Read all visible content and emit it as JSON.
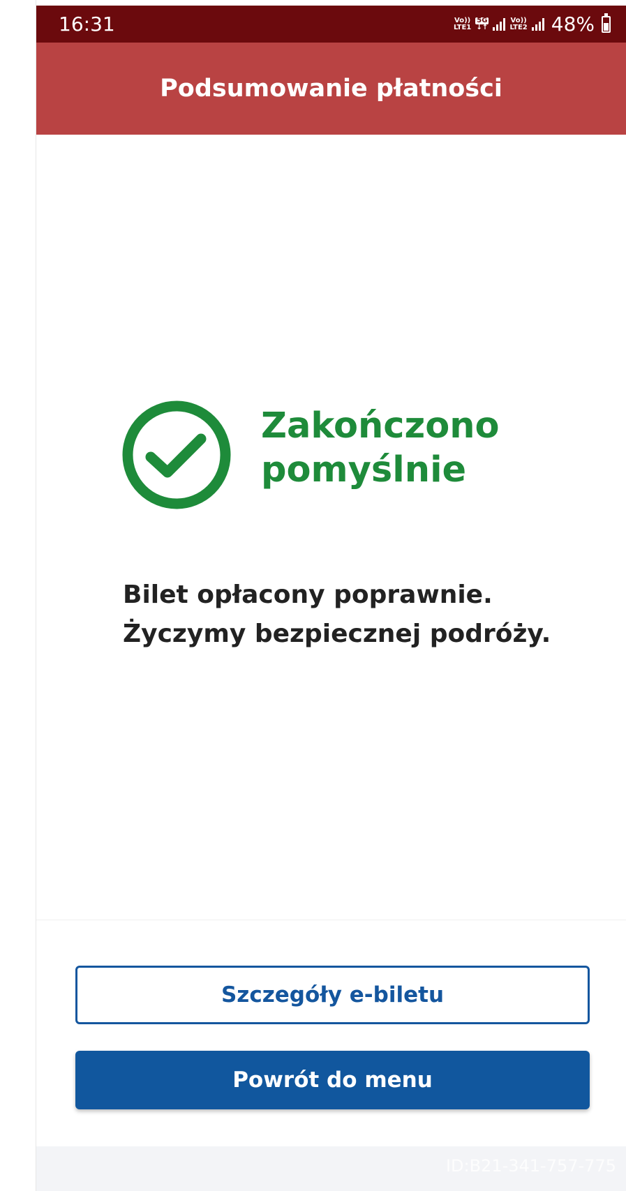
{
  "status_bar": {
    "time": "16:31",
    "network_1_top": "Vo))",
    "network_1_bottom": "LTE1",
    "network_5g": "5G",
    "network_2_top": "Vo))",
    "network_2_bottom": "LTE2",
    "battery_percent": "48%"
  },
  "header": {
    "title": "Podsumowanie płatności"
  },
  "result": {
    "status_line_1": "Zakończono",
    "status_line_2": "pomyślnie",
    "icon": "check-circle-icon",
    "color": "#1e8b3a"
  },
  "message": {
    "line_1": "Bilet opłacony poprawnie.",
    "line_2": "Życzymy bezpiecznej podróży."
  },
  "actions": {
    "details_label": "Szczegóły e-biletu",
    "menu_label": "Powrót do menu"
  },
  "footer": {
    "id_text": "ID:B21-341-757-775"
  },
  "colors": {
    "status_bar": "#6b0a0d",
    "header": "#b94343",
    "primary": "#11579e",
    "success": "#1e8b3a"
  }
}
